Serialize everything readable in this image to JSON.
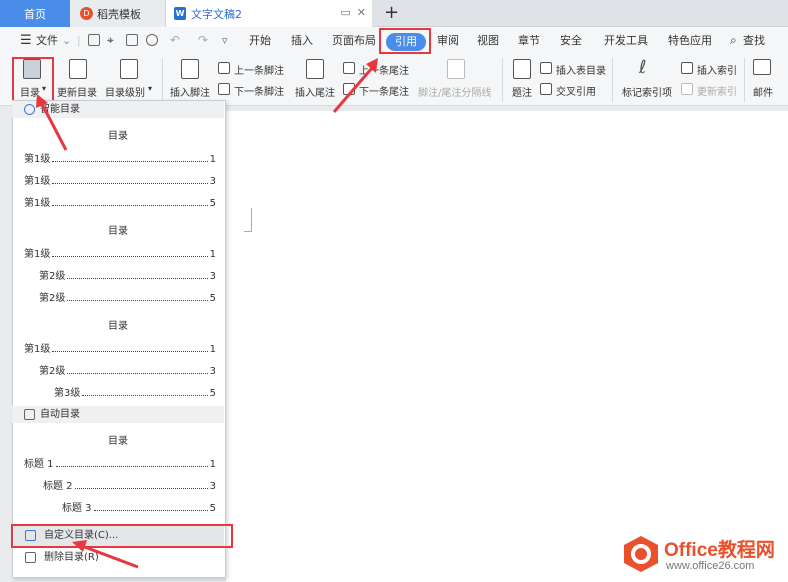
{
  "tabs": {
    "home": "首页",
    "template": "稻壳模板",
    "document": "文字文稿2",
    "new_tab": "+"
  },
  "menu": {
    "file": "文件",
    "items": [
      "开始",
      "插入",
      "页面布局",
      "引用",
      "审阅",
      "视图",
      "章节",
      "安全",
      "开发工具",
      "特色应用"
    ],
    "search": "查找"
  },
  "ribbon": {
    "toc": "目录",
    "update_toc": "更新目录",
    "toc_level": "目录级别",
    "insert_footnote": "插入脚注",
    "prev_footnote": "上一条脚注",
    "next_footnote": "下一条脚注",
    "insert_endnote": "插入尾注",
    "prev_endnote": "上一条尾注",
    "next_endnote": "下一条尾注",
    "footnote_sep": "脚注/尾注分隔线",
    "caption": "题注",
    "insert_table_toc": "插入表目录",
    "cross_ref": "交叉引用",
    "mark_index": "标记索引项",
    "insert_index": "插入索引",
    "update_index": "更新索引",
    "mail": "邮件"
  },
  "dropdown": {
    "smart_header": "智能目录",
    "auto_header": "自动目录",
    "title": "目录",
    "style1": [
      {
        "label": "第1级",
        "page": "1"
      },
      {
        "label": "第1级",
        "page": "3"
      },
      {
        "label": "第1级",
        "page": "5"
      }
    ],
    "style2": [
      {
        "label": "第1级",
        "page": "1"
      },
      {
        "label": "第2级",
        "page": "3"
      },
      {
        "label": "第2级",
        "page": "5"
      }
    ],
    "style3": [
      {
        "label": "第1级",
        "page": "1"
      },
      {
        "label": "第2级",
        "page": "3"
      },
      {
        "label": "第3级",
        "page": "5"
      }
    ],
    "auto": [
      {
        "label": "标题 1",
        "page": "1"
      },
      {
        "label": "标题 2",
        "page": "3"
      },
      {
        "label": "标题 3",
        "page": "5"
      }
    ],
    "custom_toc": "自定义目录(C)...",
    "delete_toc": "删除目录(R)"
  },
  "watermark": {
    "brand_en": "Office",
    "brand_cn": "教程网",
    "url": "www.office26.com"
  },
  "colors": {
    "accent": "#4a8de8",
    "highlight": "#e8373e",
    "brand": "#e8512c"
  }
}
